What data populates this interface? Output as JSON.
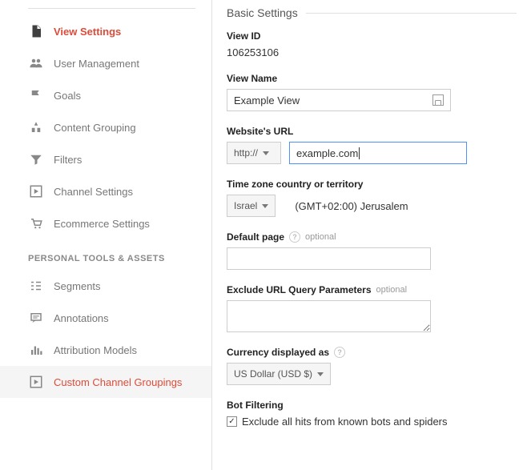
{
  "sidebar": {
    "items": [
      {
        "label": "View Settings"
      },
      {
        "label": "User Management"
      },
      {
        "label": "Goals"
      },
      {
        "label": "Content Grouping"
      },
      {
        "label": "Filters"
      },
      {
        "label": "Channel Settings"
      },
      {
        "label": "Ecommerce Settings"
      }
    ],
    "section_label": "PERSONAL TOOLS & ASSETS",
    "tools": [
      {
        "label": "Segments"
      },
      {
        "label": "Annotations"
      },
      {
        "label": "Attribution Models"
      },
      {
        "label": "Custom Channel Groupings"
      }
    ]
  },
  "main": {
    "section_title": "Basic Settings",
    "view_id": {
      "label": "View ID",
      "value": "106253106"
    },
    "view_name": {
      "label": "View Name",
      "value": "Example View"
    },
    "url": {
      "label": "Website's URL",
      "scheme": "http://",
      "domain": "example.com"
    },
    "timezone": {
      "label": "Time zone country or territory",
      "country": "Israel",
      "display": "(GMT+02:00) Jerusalem"
    },
    "default_page": {
      "label": "Default page",
      "optional": "optional",
      "value": ""
    },
    "exclude_params": {
      "label": "Exclude URL Query Parameters",
      "optional": "optional",
      "value": ""
    },
    "currency": {
      "label": "Currency displayed as",
      "value": "US Dollar (USD $)"
    },
    "bot": {
      "label": "Bot Filtering",
      "checkbox_label": "Exclude all hits from known bots and spiders",
      "checked": true
    }
  }
}
